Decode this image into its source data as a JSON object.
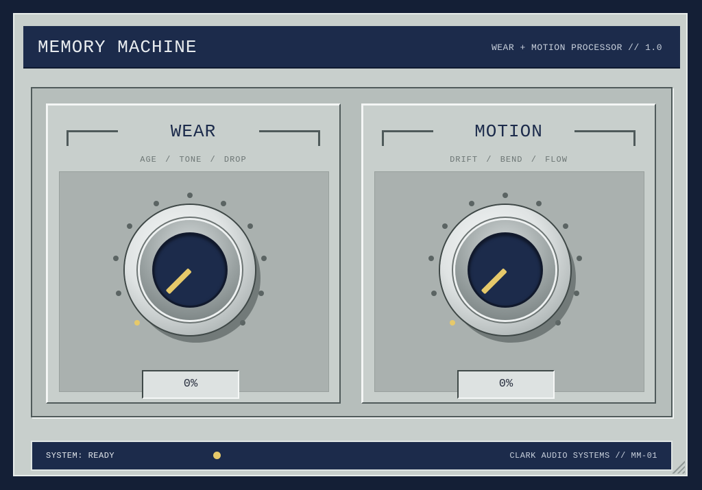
{
  "header": {
    "title": "MEMORY MACHINE",
    "subtitle": "WEAR + MOTION PROCESSOR // 1.0"
  },
  "modules": [
    {
      "id": "wear",
      "title": "WEAR",
      "subtitle": "AGE  /  TONE  /  DROP",
      "value_display": "0%",
      "value_percent": 0
    },
    {
      "id": "motion",
      "title": "MOTION",
      "subtitle": "DRIFT  /  BEND  /  FLOW",
      "value_display": "0%",
      "value_percent": 0
    }
  ],
  "footer": {
    "status": "SYSTEM: READY",
    "brand": "CLARK AUDIO SYSTEMS  //  MM-01"
  },
  "colors": {
    "accent": "#e6c96a",
    "navy": "#1c2b4b",
    "panel": "#c8cfcc",
    "tick": "#5b6463"
  },
  "icons": {
    "status_led": "status-led-icon",
    "resize": "resize-grip-icon"
  }
}
